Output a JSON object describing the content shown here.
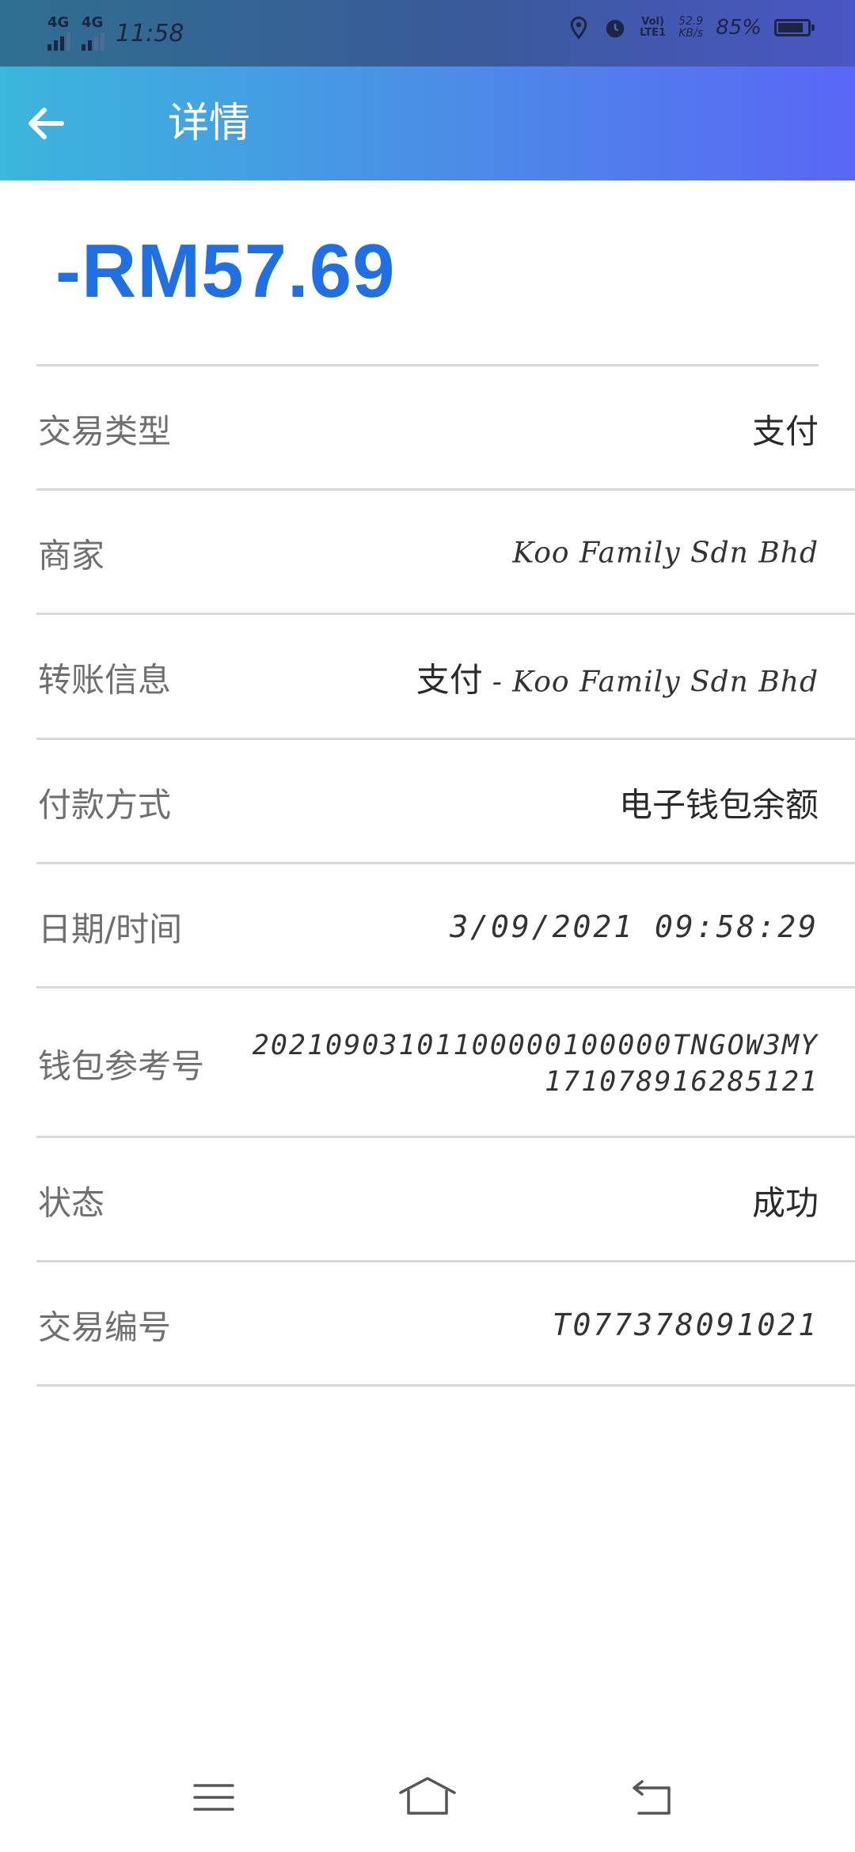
{
  "status_bar": {
    "network_1": "4G",
    "network_2": "4G",
    "time": "11:58",
    "volte_top": "Vol)",
    "volte_bottom": "LTE1",
    "speed_value": "52.9",
    "speed_unit": "KB/s",
    "battery_text": "85%",
    "battery_level": 0.85
  },
  "app_bar": {
    "title": "详情"
  },
  "amount": "-RM57.69",
  "rows": [
    {
      "label": "交易类型",
      "value": "支付"
    },
    {
      "label": "商家",
      "value": "Koo Family Sdn Bhd"
    },
    {
      "label": "转账信息",
      "value_prefix": "支付",
      "value_suffix": "- Koo Family Sdn Bhd"
    },
    {
      "label": "付款方式",
      "value": "电子钱包余额"
    },
    {
      "label": "日期/时间",
      "value": "3/09/2021 09:58:29"
    },
    {
      "label": "钱包参考号",
      "value_line1": "20210903101100000100000TNGOW3MY",
      "value_line2": "171078916285121"
    },
    {
      "label": "状态",
      "value": "成功"
    },
    {
      "label": "交易编号",
      "value": "T077378091021"
    }
  ],
  "icons": {
    "back": "arrow-left-icon",
    "menu": "menu-icon",
    "home": "home-icon",
    "return": "return-icon"
  }
}
